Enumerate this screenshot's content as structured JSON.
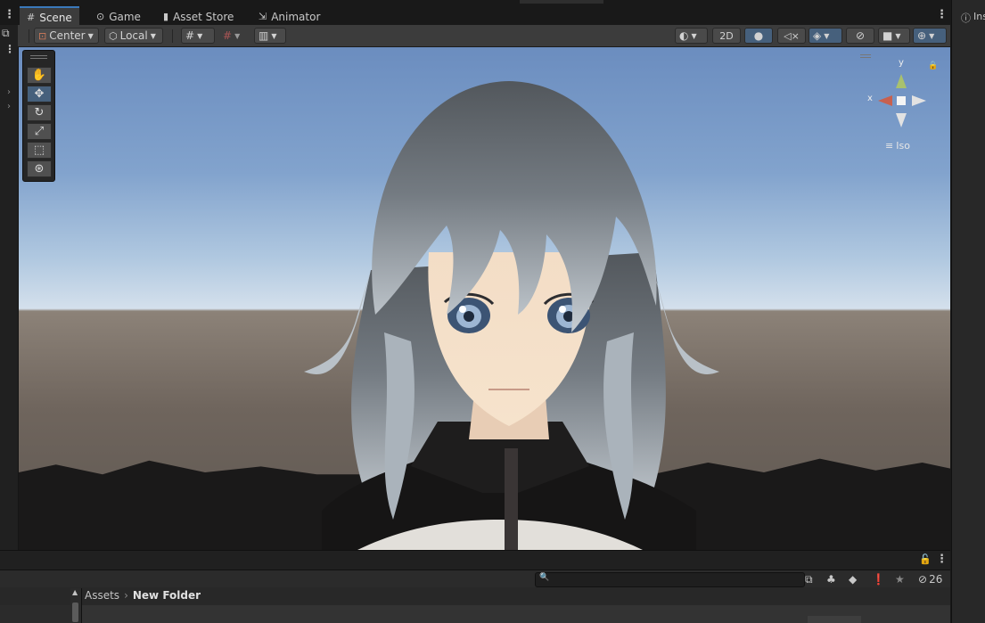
{
  "tabs": [
    {
      "label": "Scene",
      "icon": "#"
    },
    {
      "label": "Game",
      "icon": "⊙"
    },
    {
      "label": "Asset Store",
      "icon": "▮"
    },
    {
      "label": "Animator",
      "icon": "⇲"
    }
  ],
  "toolbar": {
    "pivot_label": "Center",
    "space_label": "Local",
    "mode_2d_label": "2D"
  },
  "gizmo": {
    "y_label": "y",
    "x_label": "x",
    "projection_label": "Iso"
  },
  "project": {
    "hidden_count": "26",
    "breadcrumb_root": "Assets",
    "breadcrumb_current": "New Folder"
  },
  "inspector": {
    "tab_label": "Ins"
  },
  "colors": {
    "accent": "#3a79bb",
    "toggle_on": "#46607c",
    "panel": "#3c3c3c"
  }
}
